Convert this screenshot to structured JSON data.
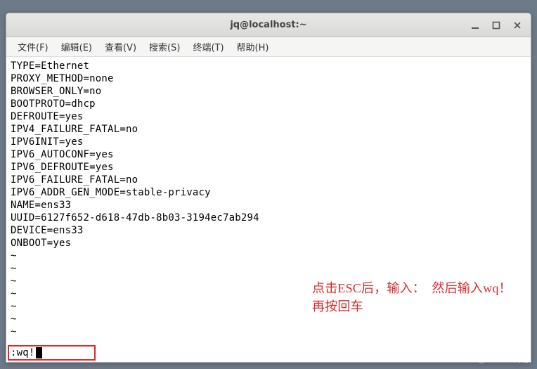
{
  "window": {
    "title": "jq@localhost:~"
  },
  "menu": {
    "file": "文件(F)",
    "edit": "编辑(E)",
    "view": "查看(V)",
    "search": "搜索(S)",
    "terminal": "终端(T)",
    "help": "帮助(H)"
  },
  "config_lines": [
    "TYPE=Ethernet",
    "PROXY_METHOD=none",
    "BROWSER_ONLY=no",
    "BOOTPROTO=dhcp",
    "DEFROUTE=yes",
    "IPV4_FAILURE_FATAL=no",
    "IPV6INIT=yes",
    "IPV6_AUTOCONF=yes",
    "IPV6_DEFROUTE=yes",
    "IPV6_FAILURE_FATAL=no",
    "IPV6_ADDR_GEN_MODE=stable-privacy",
    "NAME=ens33",
    "UUID=6127f652-d618-47db-8b03-3194ec7ab294",
    "DEVICE=ens33",
    "ONBOOT=yes"
  ],
  "tilde_count": 7,
  "annotation": {
    "line1": "点击ESC后，输入：  然后输入wq！",
    "line2": "再按回车"
  },
  "command": {
    "text": ":wq!"
  },
  "watermark": "@51CTO博客"
}
